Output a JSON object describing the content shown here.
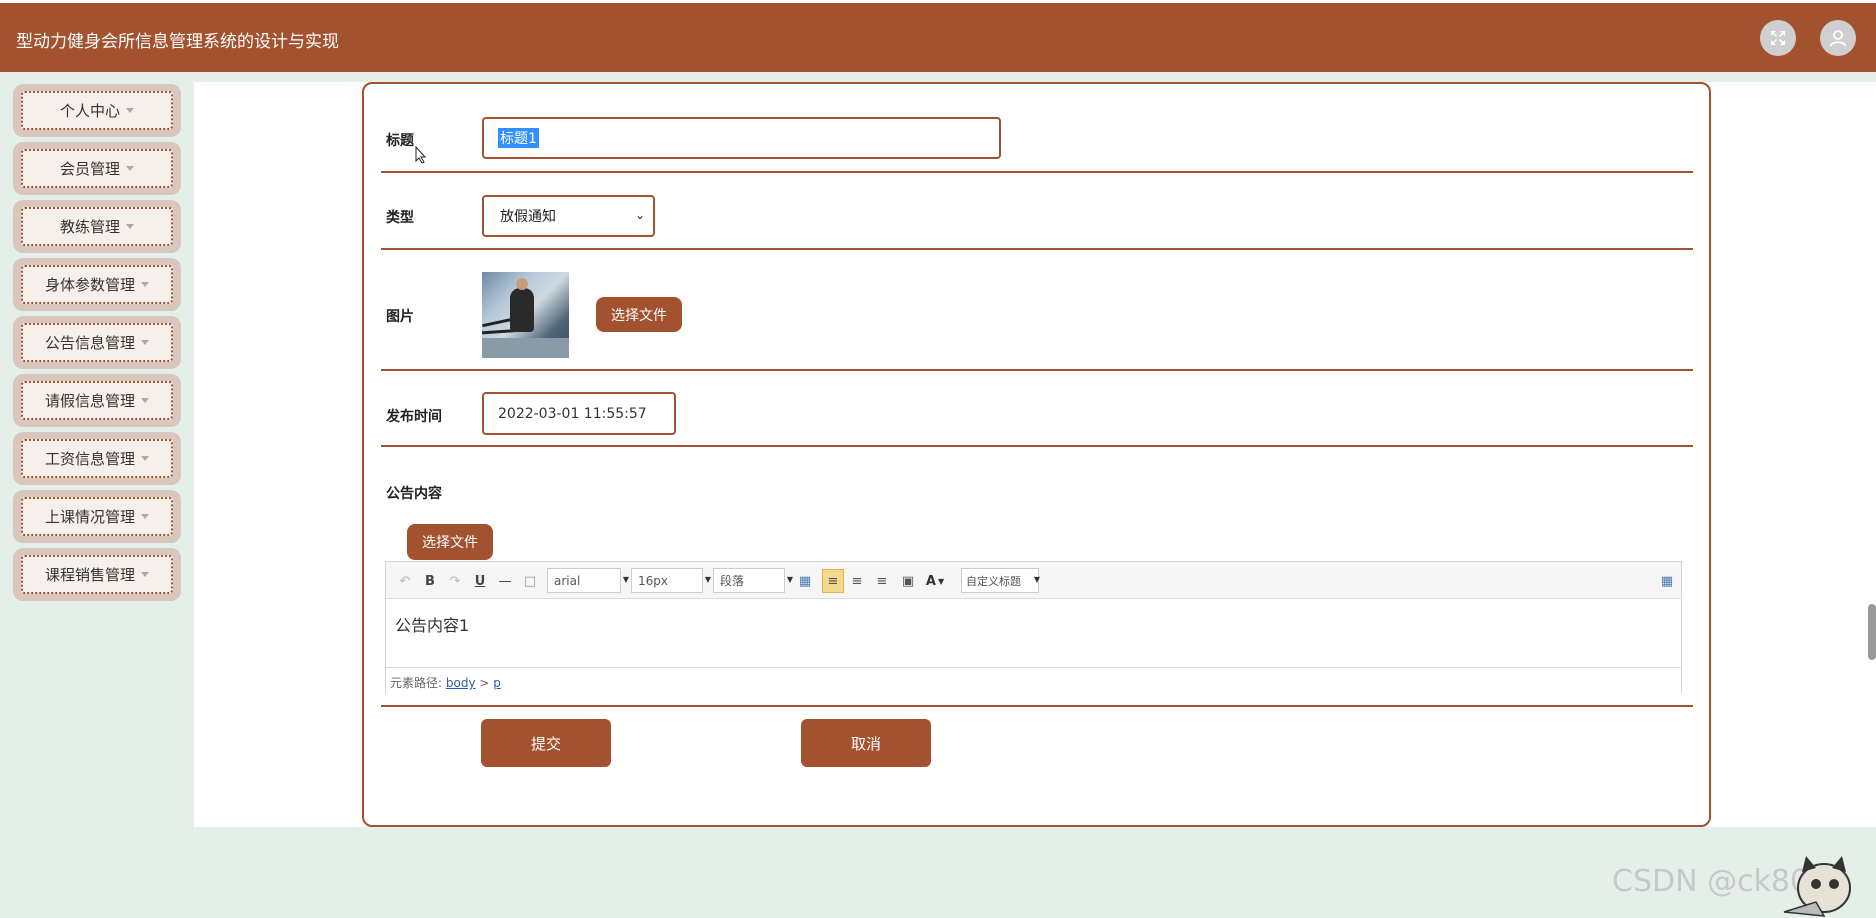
{
  "header": {
    "app_title": "型动力健身会所信息管理系统的设计与实现",
    "fullscreen_icon": "fullscreen-icon",
    "user_icon": "user-icon",
    "accent_color": "#a35230"
  },
  "sidebar": {
    "items": [
      {
        "label": "个人中心"
      },
      {
        "label": "会员管理"
      },
      {
        "label": "教练管理"
      },
      {
        "label": "身体参数管理"
      },
      {
        "label": "公告信息管理"
      },
      {
        "label": "请假信息管理"
      },
      {
        "label": "工资信息管理"
      },
      {
        "label": "上课情况管理"
      },
      {
        "label": "课程销售管理"
      }
    ]
  },
  "form": {
    "title_label": "标题",
    "title_value": "标题1",
    "type_label": "类型",
    "type_value": "放假通知",
    "image_label": "图片",
    "choose_file": "选择文件",
    "publish_time_label": "发布时间",
    "publish_time_value": "2022-03-01 11:55:57",
    "content_label": "公告内容",
    "content_choose_file": "选择文件",
    "submit": "提交",
    "cancel": "取消"
  },
  "editor": {
    "font_family": "arial",
    "font_size": "16px",
    "paragraph": "段落",
    "custom_title": "自定义标题",
    "content": "公告内容1",
    "path_label": "元素路径:",
    "path_body": "body",
    "path_sep": ">",
    "path_p": "p"
  },
  "watermark": "CSDN @ck8017"
}
